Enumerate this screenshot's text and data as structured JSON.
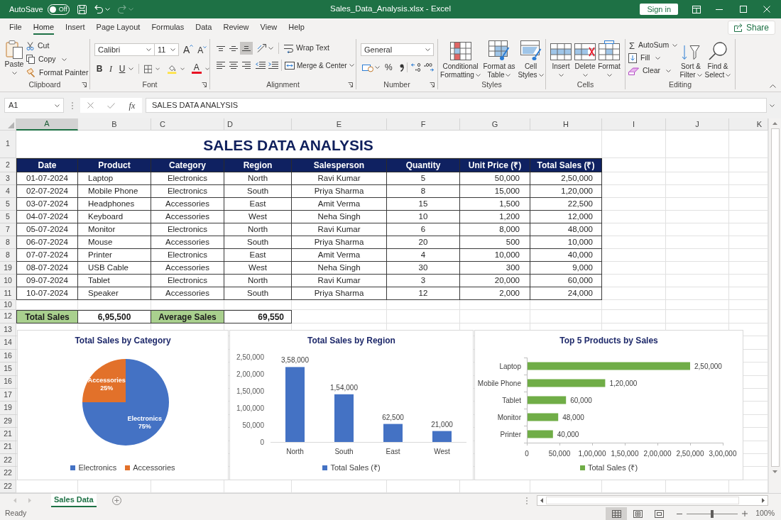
{
  "title_bar": {
    "autosave": {
      "label": "AutoSave",
      "on": false,
      "state_text": "Off"
    },
    "redo_disabled": true,
    "document_title": "Sales_Data_Analysis.xlsx - Excel",
    "sign_in": "Sign in"
  },
  "menu_tabs": [
    {
      "label": "File",
      "selected": false
    },
    {
      "label": "Home",
      "selected": true
    },
    {
      "label": "Insert",
      "selected": false
    },
    {
      "label": "Page Layout",
      "selected": false
    },
    {
      "label": "Formulas",
      "selected": false
    },
    {
      "label": "Data",
      "selected": false
    },
    {
      "label": "Review",
      "selected": false
    },
    {
      "label": "View",
      "selected": false
    },
    {
      "label": "Help",
      "selected": false
    }
  ],
  "share": "Share",
  "ribbon": {
    "clipboard": {
      "label": "Clipboard",
      "paste": "Paste",
      "cut": "Cut",
      "copy": "Copy",
      "format_painter": "Format Painter"
    },
    "font": {
      "label": "Font",
      "font_name": "Calibri",
      "font_size": "11",
      "grow_glyph": "A",
      "shrink_glyph": "A",
      "style_buttons": [
        {
          "label": "B",
          "kind": "bold"
        },
        {
          "label": "I",
          "kind": "italic"
        },
        {
          "label": "U",
          "kind": "underline"
        }
      ],
      "font_color_glyph": "A"
    },
    "alignment": {
      "label": "Alignment",
      "vertical_align": [
        {
          "kind": "top",
          "selected": false
        },
        {
          "kind": "middle",
          "selected": false
        },
        {
          "kind": "bottom",
          "selected": true
        }
      ],
      "wrap_text": "Wrap Text",
      "merge_center": "Merge & Center"
    },
    "number": {
      "label": "Number",
      "format": "General",
      "percent_glyph": "%"
    },
    "styles": {
      "label": "Styles",
      "buttons": [
        {
          "label": "Conditional Formatting",
          "kind": "conditional"
        },
        {
          "label": "Format as Table",
          "kind": "table"
        },
        {
          "label": "Cell Styles",
          "kind": "cell_styles"
        }
      ]
    },
    "cells": {
      "label": "Cells",
      "buttons": [
        {
          "label": "Insert",
          "kind": "insert"
        },
        {
          "label": "Delete",
          "kind": "delete"
        },
        {
          "label": "Format",
          "kind": "format"
        }
      ]
    },
    "editing": {
      "label": "Editing",
      "sum_glyph": "Σ",
      "autosum": "AutoSum",
      "fill": "Fill",
      "clear": "Clear",
      "sort_filter": "Sort & Filter",
      "find_select": "Find & Select"
    }
  },
  "formula_bar": {
    "name_box": "A1",
    "function_label": "fx",
    "formula": "SALES DATA ANALYSIS"
  },
  "sheet": {
    "columns": [
      {
        "label": "A",
        "selected": true
      },
      {
        "label": "B",
        "selected": false
      },
      {
        "label": "C",
        "selected": false
      },
      {
        "label": "D",
        "selected": false
      },
      {
        "label": "E",
        "selected": false
      },
      {
        "label": "F",
        "selected": false
      },
      {
        "label": "G",
        "selected": false
      },
      {
        "label": "H",
        "selected": false
      },
      {
        "label": "I",
        "selected": false
      },
      {
        "label": "J",
        "selected": false
      },
      {
        "label": "K",
        "selected": false
      }
    ],
    "row_numbers": [
      "1",
      "2",
      "3",
      "4",
      "5",
      "5",
      "7",
      "8",
      "8",
      "19",
      "10",
      "11",
      "10",
      "12",
      "13",
      "14",
      "16",
      "15",
      "16",
      "17",
      "19",
      "29",
      "21",
      "21",
      "22",
      "22",
      "22"
    ],
    "title": "SALES DATA ANALYSIS",
    "table": {
      "columns": [
        "Date",
        "Product",
        "Category",
        "Region",
        "Salesperson",
        "Quantity",
        "Unit Price (₹)",
        "Total Sales (₹)"
      ],
      "rows": [
        [
          "01-07-2024",
          "Laptop",
          "Electronics",
          "North",
          "Ravi Kumar",
          "5",
          "50,000",
          "2,50,000"
        ],
        [
          "02-07-2024",
          "Mobile Phone",
          "Electronics",
          "South",
          "Priya Sharma",
          "8",
          "15,000",
          "1,20,000"
        ],
        [
          "03-07-2024",
          "Headphones",
          "Accessories",
          "East",
          "Amit Verma",
          "15",
          "1,500",
          "22,500"
        ],
        [
          "04-07-2024",
          "Keyboard",
          "Accessories",
          "West",
          "Neha Singh",
          "10",
          "1,200",
          "12,000"
        ],
        [
          "05-07-2024",
          "Monitor",
          "Electronics",
          "North",
          "Ravi Kumar",
          "6",
          "8,000",
          "48,000"
        ],
        [
          "06-07-2024",
          "Mouse",
          "Accessories",
          "South",
          "Priya Sharma",
          "20",
          "500",
          "10,000"
        ],
        [
          "07-07-2024",
          "Printer",
          "Electronics",
          "East",
          "Amit Verma",
          "4",
          "10,000",
          "40,000"
        ],
        [
          "08-07-2024",
          "USB Cable",
          "Accessories",
          "West",
          "Neha Singh",
          "30",
          "300",
          "9,000"
        ],
        [
          "09-07-2024",
          "Tablet",
          "Electronics",
          "North",
          "Ravi Kumar",
          "3",
          "20,000",
          "60,000"
        ],
        [
          "10-07-2024",
          "Speaker",
          "Accessories",
          "South",
          "Priya Sharma",
          "12",
          "2,000",
          "24,000"
        ]
      ]
    },
    "summary": [
      {
        "label": "Total Sales",
        "value": "6,95,500"
      },
      {
        "label": "Average Sales",
        "value": "69,550"
      }
    ],
    "charts": [
      {
        "chart_data": {
          "type": "pie",
          "title": "Total Sales by Category",
          "categories": [
            "Electronics",
            "Accessories"
          ],
          "values": [
            75,
            25
          ],
          "value_labels": [
            "75%",
            "25%"
          ]
        },
        "legend": [
          {
            "label": "Electronics",
            "color": "#4472c4"
          },
          {
            "label": "Accessories",
            "color": "#e2712a"
          }
        ]
      },
      {
        "chart_data": {
          "type": "bar",
          "title": "Total Sales by Region",
          "categories": [
            "North",
            "South",
            "East",
            "West"
          ],
          "series": [
            {
              "name": "Total Sales (₹)",
              "color": "#4472c4",
              "values": [
                220000,
                140000,
                53000,
                32000
              ]
            }
          ],
          "ylim": [
            0,
            250000
          ],
          "yticks": [
            {
              "value": 0,
              "label": "0"
            },
            {
              "value": 50000,
              "label": "50,000"
            },
            {
              "value": 100000,
              "label": "1,00,000"
            },
            {
              "value": 150000,
              "label": "1,50,000"
            },
            {
              "value": 200000,
              "label": "2,00,000"
            },
            {
              "value": 250000,
              "label": "2,50,000"
            }
          ],
          "value_labels": [
            "3,58,000",
            "1,54,000",
            "62,500",
            "21,000"
          ]
        }
      },
      {
        "chart_data": {
          "type": "bar",
          "orientation": "horizontal",
          "title": "Top 5 Products by Sales",
          "categories": [
            "Laptop",
            "Mobile Phone",
            "Tablet",
            "Monitor",
            "Printer"
          ],
          "series": [
            {
              "name": "Total Sales (₹)",
              "color": "#70ad47",
              "values": [
                250000,
                120000,
                60000,
                48000,
                40000
              ]
            }
          ],
          "xlim": [
            0,
            300000
          ],
          "xticks": [
            {
              "value": 0,
              "label": "0"
            },
            {
              "value": 50000,
              "label": "50,000"
            },
            {
              "value": 100000,
              "label": "1,00,000"
            },
            {
              "value": 150000,
              "label": "1,50,000"
            },
            {
              "value": 200000,
              "label": "2,00,000"
            },
            {
              "value": 250000,
              "label": "2,50,000"
            },
            {
              "value": 300000,
              "label": "3,00,000"
            }
          ],
          "value_labels": [
            "2,50,000",
            "1,20,000",
            "60,000",
            "48,000",
            "40,000"
          ]
        }
      }
    ]
  },
  "sheet_tabs": [
    {
      "label": "Sales Data",
      "selected": true
    }
  ],
  "status_bar": {
    "status": "Ready",
    "views": [
      {
        "kind": "normal",
        "selected": true
      },
      {
        "kind": "page_layout",
        "selected": false
      },
      {
        "kind": "page_break",
        "selected": false
      }
    ],
    "zoom": {
      "level": 0.5,
      "reading": "100%"
    }
  }
}
